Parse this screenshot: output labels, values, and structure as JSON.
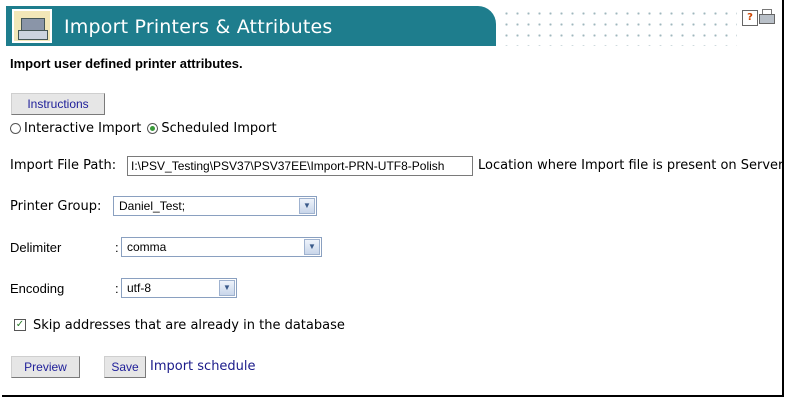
{
  "header": {
    "title": "Import Printers & Attributes"
  },
  "subtitle": "Import user defined printer attributes.",
  "instructions_button": "Instructions",
  "import_mode": {
    "options": [
      {
        "label": "Interactive Import",
        "selected": false
      },
      {
        "label": "Scheduled Import",
        "selected": true
      }
    ]
  },
  "import_file_path": {
    "label": "Import File Path:",
    "value": "I:\\PSV_Testing\\PSV37\\PSV37EE\\Import-PRN-UTF8-Polish",
    "hint": "Location where Import file is present on Server"
  },
  "printer_group": {
    "label": "Printer Group:",
    "value": "Daniel_Test;"
  },
  "delimiter": {
    "label": "Delimiter",
    "separator": ":",
    "value": "comma"
  },
  "encoding": {
    "label": "Encoding",
    "separator": ":",
    "value": "utf-8"
  },
  "skip_addresses": {
    "label": "Skip addresses that are already in the database",
    "checked": true
  },
  "actions": {
    "preview": "Preview",
    "save": "Save",
    "import_schedule": "Import schedule"
  },
  "colors": {
    "header_bg": "#1e7d8d",
    "link": "#1a1a8a",
    "button_text": "#20209a"
  }
}
